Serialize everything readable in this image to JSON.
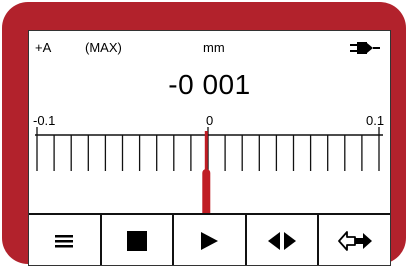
{
  "status": {
    "mode": "+A",
    "hold": "(MAX)",
    "unit": "mm"
  },
  "icons": {
    "power": "power-plug-icon"
  },
  "reading": {
    "value": "-0 001"
  },
  "scale": {
    "min_label": "-0.1",
    "mid_label": "0",
    "max_label": "0.1",
    "min": -0.1,
    "max": 0.1,
    "tick_count": 21,
    "pointer_value": -0.001,
    "pointer_color": "#c01d24"
  },
  "toolbar": [
    {
      "name": "menu-button",
      "icon": "menu-icon"
    },
    {
      "name": "stop-button",
      "icon": "stop-icon"
    },
    {
      "name": "play-button",
      "icon": "play-icon"
    },
    {
      "name": "left-right-button",
      "icon": "left-right-arrows-icon"
    },
    {
      "name": "enter-button",
      "icon": "enter-arrow-icon"
    }
  ],
  "colors": {
    "bezel": "#b2222c",
    "screen": "#ffffff",
    "ink": "#111111"
  }
}
